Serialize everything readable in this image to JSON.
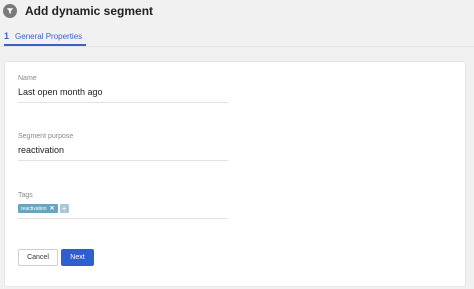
{
  "header": {
    "title": "Add dynamic segment",
    "icon": "filter-icon"
  },
  "tabs": [
    {
      "number": "1",
      "label": "General Properties",
      "active": true
    }
  ],
  "form": {
    "name": {
      "label": "Name",
      "value": "Last open month ago"
    },
    "purpose": {
      "label": "Segment purpose",
      "value": "reactivation"
    },
    "tags": {
      "label": "Tags",
      "items": [
        {
          "label": "reactivation",
          "remove_icon": "close-icon"
        }
      ],
      "add_icon": "plus-icon"
    }
  },
  "buttons": {
    "cancel": "Cancel",
    "next": "Next"
  },
  "colors": {
    "accent": "#3a62c9",
    "primary_button": "#2f5fcf",
    "tag": "#6ba5bd",
    "background": "#f1f1f1"
  }
}
